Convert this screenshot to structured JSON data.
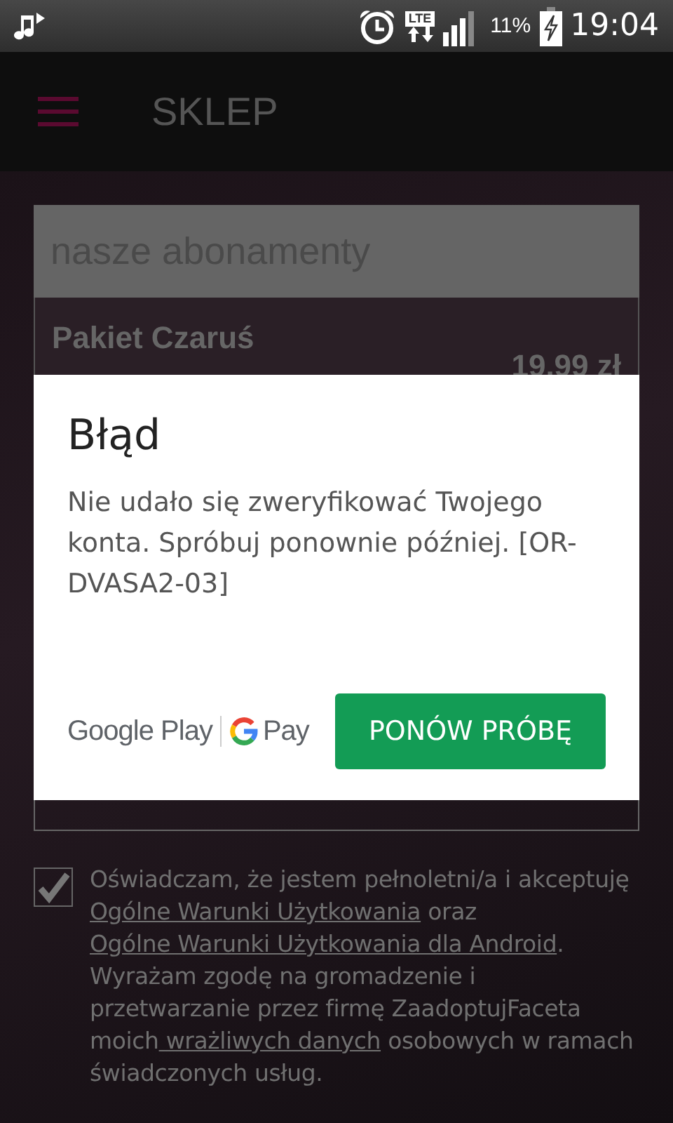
{
  "status_bar": {
    "network": "LTE",
    "battery": "11%",
    "time": "19:04"
  },
  "app_bar": {
    "title": "SKLEP"
  },
  "store": {
    "header": "nasze abonamenty",
    "package": {
      "name": "Pakiet Czaruś",
      "price": "19.99 zł"
    }
  },
  "consent": {
    "checked": true,
    "segments": [
      {
        "text": "Oświadczam, że jestem pełnoletni/a i akceptuję",
        "link": false
      },
      {
        "text": " Ogólne Warunki Użytkowania",
        "link": true
      },
      {
        "text": " oraz",
        "link": false
      },
      {
        "text": " Ogólne Warunki Użytkowania dla Android",
        "link": true
      },
      {
        "text": ". Wyrażam zgodę na gromadzenie i przetwarzanie przez firmę ZaadoptujFaceta moich",
        "link": false
      },
      {
        "text": " wrażliwych danych",
        "link": true
      },
      {
        "text": " osobowych w ramach świadczonych usług.",
        "link": false
      }
    ]
  },
  "dialog": {
    "title": "Błąd",
    "message": "Nie udało się zweryfikować Twojego konta. Spróbuj ponownie później. [OR-DVASA2-03]",
    "brand": "Google Play",
    "pay": "Pay",
    "button": "PONÓW PRÓBĘ"
  }
}
